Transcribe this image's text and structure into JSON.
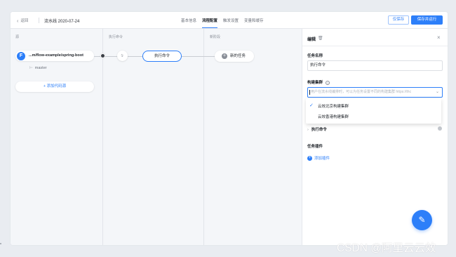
{
  "header": {
    "back_label": "返回",
    "pipeline_title": "流水线 2020-07-24",
    "tabs": [
      {
        "label": "基本信息",
        "active": false
      },
      {
        "label": "流程配置",
        "active": true
      },
      {
        "label": "触发设置",
        "active": false
      },
      {
        "label": "变量和缓存",
        "active": false
      }
    ],
    "save_label": "仅保存",
    "save_run_label": "保存并运行"
  },
  "canvas": {
    "columns": [
      {
        "title": "源"
      },
      {
        "title": "执行命令"
      },
      {
        "title": "新阶段"
      }
    ],
    "source": {
      "icon_letter": "F",
      "label": "...m/flow-example/spring-boot",
      "branch": "master"
    },
    "add_source_label": "+ 添加代码源",
    "task_node_label": "执行命令",
    "new_task_label": "新的任务"
  },
  "panel": {
    "title": "编辑",
    "task_name_label": "任务名称",
    "task_name_value": "执行命令",
    "cluster_label": "构建集群",
    "cluster_placeholder": "用户在流水线编排时，可以为任务设置不同的构建集群 https://thc",
    "cluster_options": [
      {
        "label": "云效北京构建集群",
        "selected": true
      },
      {
        "label": "云效香港构建集群",
        "selected": false
      }
    ],
    "execute_section_label": "执行命令",
    "plugins_label": "任务插件",
    "add_plugin_label": "添加插件"
  },
  "watermark": "CSDN @阿里云云效",
  "colors": {
    "accent": "#2d7ff9",
    "background": "#e9ecf1",
    "panel": "#ffffff"
  },
  "icons": {
    "back": "chevron-left-icon",
    "trash": "trash-icon",
    "close": "close-icon",
    "help": "question-icon",
    "fab": "chat-icon"
  }
}
